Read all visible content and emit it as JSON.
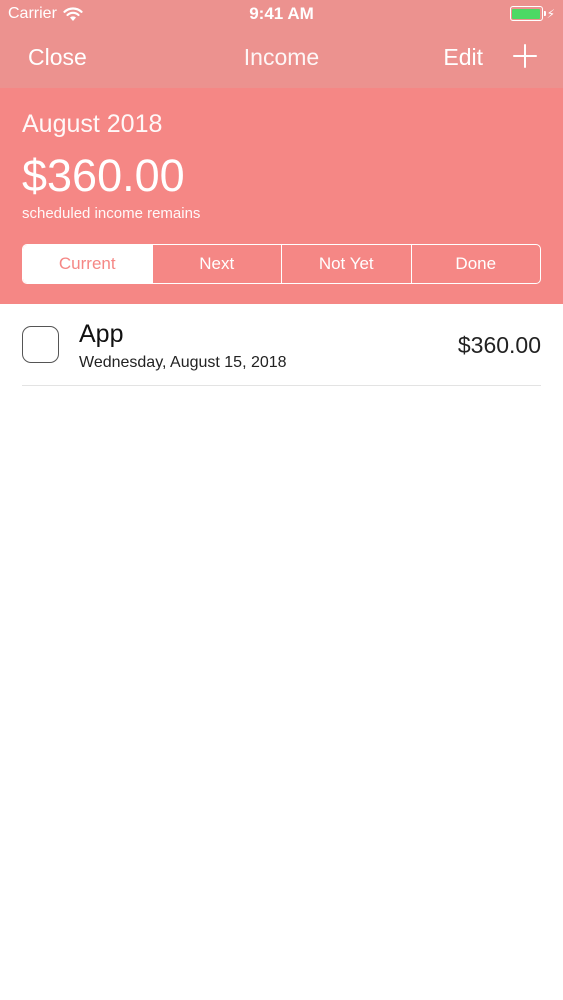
{
  "status_bar": {
    "carrier": "Carrier",
    "time": "9:41 AM",
    "battery_color": "#4cd964"
  },
  "nav": {
    "close_label": "Close",
    "title": "Income",
    "edit_label": "Edit",
    "add_icon": "plus-icon"
  },
  "summary": {
    "month": "August 2018",
    "amount": "$360.00",
    "caption": "scheduled income remains"
  },
  "segments": [
    {
      "label": "Current",
      "selected": true
    },
    {
      "label": "Next",
      "selected": false
    },
    {
      "label": "Not Yet",
      "selected": false
    },
    {
      "label": "Done",
      "selected": false
    }
  ],
  "items": [
    {
      "title": "App",
      "date": "Wednesday, August 15, 2018",
      "amount": "$360.00",
      "checked": false
    }
  ],
  "colors": {
    "nav_background": "#ec928f",
    "header_background": "#f58785",
    "text_on_accent": "#ffffff"
  }
}
